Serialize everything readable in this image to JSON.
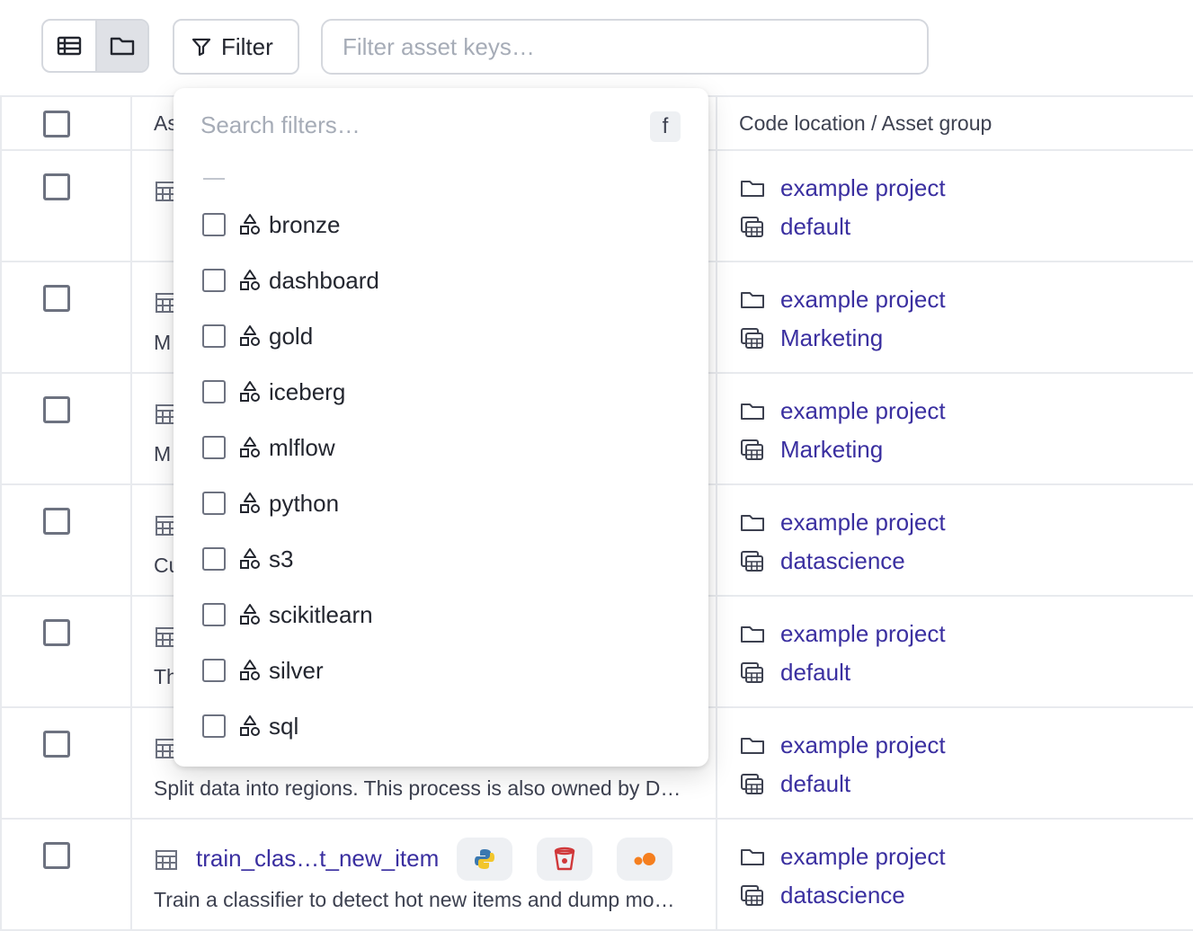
{
  "toolbar": {
    "filter_label": "Filter",
    "search_placeholder": "Filter asset keys…",
    "view_toggle": [
      "list-view",
      "folder-view"
    ]
  },
  "table": {
    "headers": {
      "asset": "As",
      "location": "Code location / Asset group"
    },
    "rows": [
      {
        "name": "",
        "description": "",
        "location": "example project",
        "group": "default"
      },
      {
        "name": "",
        "description": "M",
        "location": "example project",
        "group": "Marketing"
      },
      {
        "name": "",
        "description": "M",
        "location": "example project",
        "group": "Marketing"
      },
      {
        "name": "",
        "description": "Cu",
        "location": "example project",
        "group": "datascience"
      },
      {
        "name": "",
        "description": "Th",
        "location": "example project",
        "group": "default"
      },
      {
        "name": "",
        "description": "Split data into regions. This process is also owned by D…",
        "location": "example project",
        "group": "default"
      },
      {
        "name": "train_clas…t_new_item",
        "description": "Train a classifier to detect hot new items and dump mo…",
        "location": "example project",
        "group": "datascience",
        "kinds": [
          "python",
          "s3",
          "mlflow"
        ]
      }
    ]
  },
  "dropdown": {
    "search_placeholder": "Search filters…",
    "shortcut": "f",
    "tags": [
      "bronze",
      "dashboard",
      "gold",
      "iceberg",
      "mlflow",
      "python",
      "s3",
      "scikitlearn",
      "silver",
      "sql"
    ]
  }
}
